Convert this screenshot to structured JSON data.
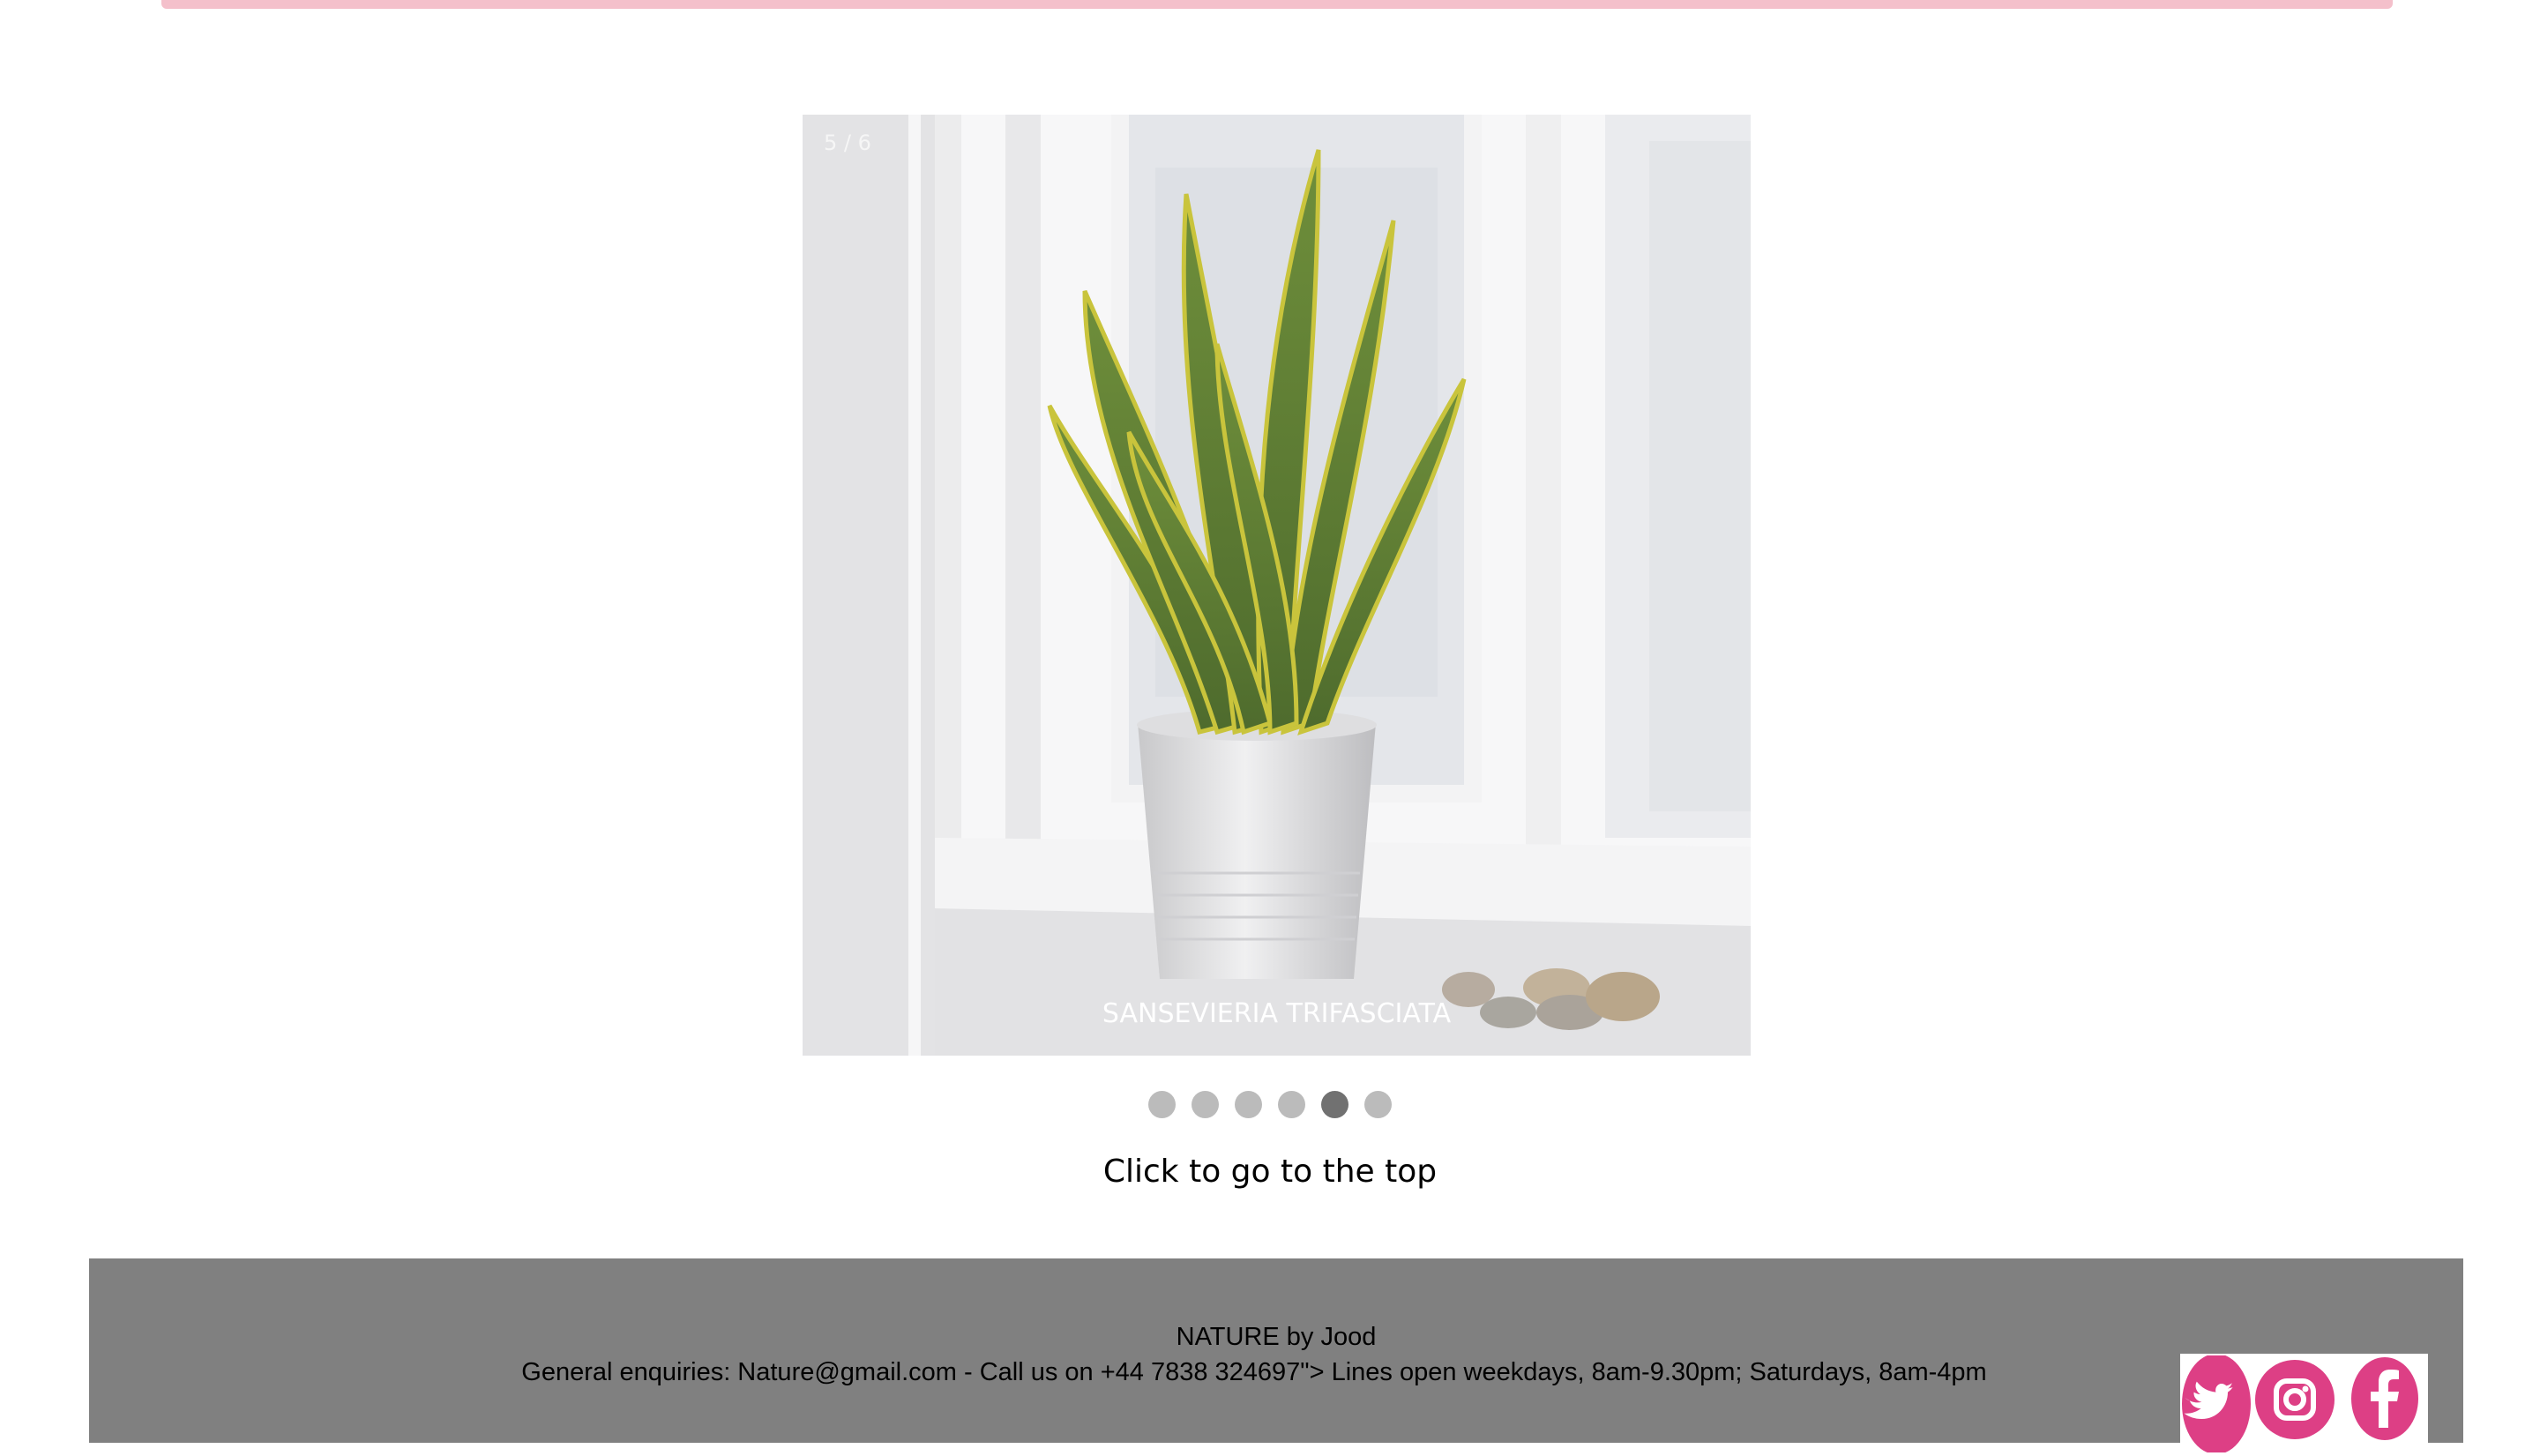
{
  "slideshow": {
    "counter": "5 / 6",
    "caption": "SANSEVIERIA TRIFASCIATA",
    "slide_count": 6,
    "active_index": 5
  },
  "nav": {
    "top_link": "Click to go to the top"
  },
  "footer": {
    "brand": "NATURE by Jood",
    "contact": "General enquiries: Nature@gmail.com - Call us on +44 7838 324697\"> Lines open weekdays, 8am-9.30pm; Saturdays, 8am-4pm"
  },
  "social": {
    "icons": [
      "twitter-icon",
      "instagram-icon",
      "facebook-icon"
    ],
    "color": "#dd3f85"
  },
  "colors": {
    "top_bar": "#f4c0cb",
    "footer_bg": "#808080",
    "dot_inactive": "#bbbbbb",
    "dot_active": "#717171"
  }
}
